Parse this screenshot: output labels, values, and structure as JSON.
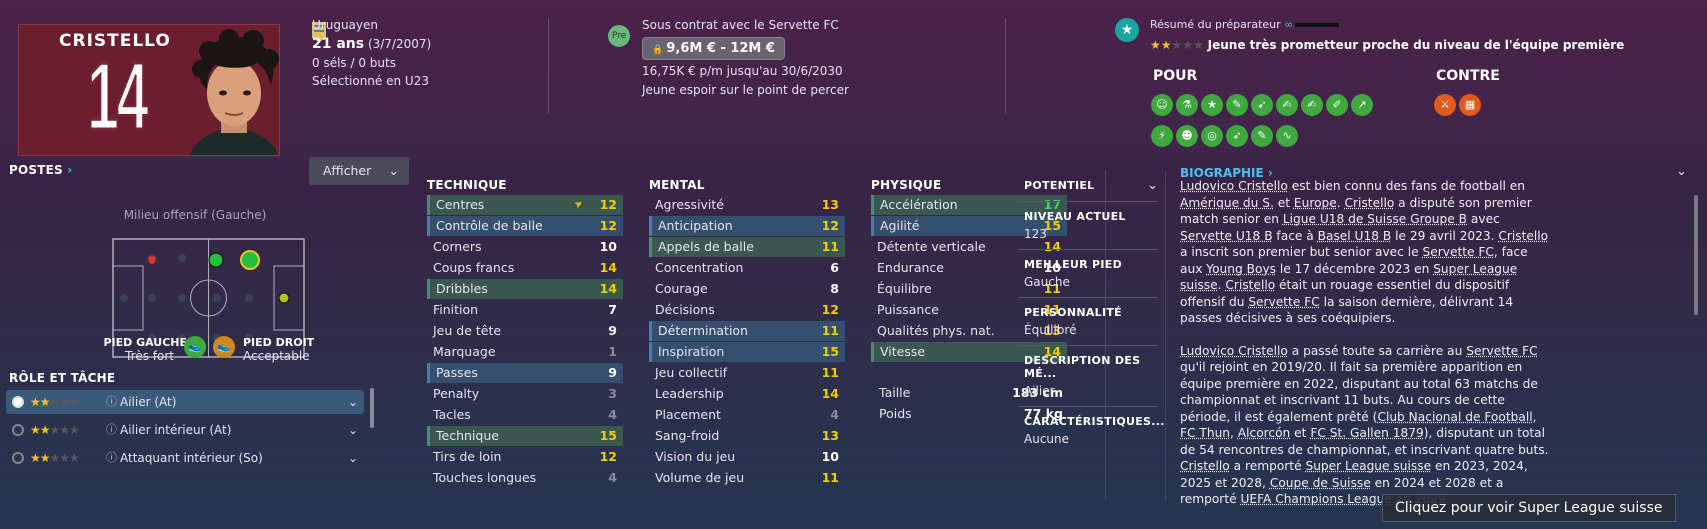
{
  "player": {
    "name": "CRISTELLO",
    "number": "14"
  },
  "info": {
    "nationality": "Uruguayen",
    "age": "21 ans",
    "dob": "(3/7/2007)",
    "caps": "0 séls / 0 buts",
    "selection": "Sélectionné en U23"
  },
  "contract": {
    "badge": "Pre",
    "title": "Sous contrat avec le Servette FC",
    "value": "9,6M € - 12M €",
    "wage": "16,75K € p/m jusqu'au 30/6/2030",
    "status": "Jeune espoir sur le point de percer"
  },
  "coach": {
    "title": "Résumé du préparateur",
    "summary": "Jeune très prometteur proche du niveau de l'équipe première",
    "stars": 2,
    "pour": "POUR",
    "contre": "CONTRE"
  },
  "positions": {
    "title": "POSTES",
    "button": "Afficher",
    "position": "Milieu offensif (Gauche)",
    "left_foot_label": "PIED GAUCHE",
    "left_foot": "Très fort",
    "right_foot_label": "PIED DROIT",
    "right_foot": "Acceptable"
  },
  "roles": {
    "title": "RÔLE ET TÂCHE",
    "items": [
      {
        "label": "Ailier (At)"
      },
      {
        "label": "Ailier intérieur (At)"
      },
      {
        "label": "Attaquant intérieur (So)"
      }
    ]
  },
  "technique": {
    "title": "TECHNIQUE",
    "items": [
      {
        "n": "Centres",
        "v": "12"
      },
      {
        "n": "Contrôle de balle",
        "v": "12"
      },
      {
        "n": "Corners",
        "v": "10"
      },
      {
        "n": "Coups francs",
        "v": "14"
      },
      {
        "n": "Dribbles",
        "v": "14"
      },
      {
        "n": "Finition",
        "v": "7"
      },
      {
        "n": "Jeu de tête",
        "v": "9"
      },
      {
        "n": "Marquage",
        "v": "1"
      },
      {
        "n": "Passes",
        "v": "9"
      },
      {
        "n": "Penalty",
        "v": "3"
      },
      {
        "n": "Tacles",
        "v": "4"
      },
      {
        "n": "Technique",
        "v": "15"
      },
      {
        "n": "Tirs de loin",
        "v": "12"
      },
      {
        "n": "Touches longues",
        "v": "4"
      }
    ]
  },
  "mental": {
    "title": "MENTAL",
    "items": [
      {
        "n": "Agressivité",
        "v": "13"
      },
      {
        "n": "Anticipation",
        "v": "12"
      },
      {
        "n": "Appels de balle",
        "v": "11"
      },
      {
        "n": "Concentration",
        "v": "6"
      },
      {
        "n": "Courage",
        "v": "8"
      },
      {
        "n": "Décisions",
        "v": "12"
      },
      {
        "n": "Détermination",
        "v": "11"
      },
      {
        "n": "Inspiration",
        "v": "15"
      },
      {
        "n": "Jeu collectif",
        "v": "11"
      },
      {
        "n": "Leadership",
        "v": "14"
      },
      {
        "n": "Placement",
        "v": "4"
      },
      {
        "n": "Sang-froid",
        "v": "13"
      },
      {
        "n": "Vision du jeu",
        "v": "10"
      },
      {
        "n": "Volume de jeu",
        "v": "11"
      }
    ]
  },
  "physique": {
    "title": "PHYSIQUE",
    "items": [
      {
        "n": "Accélération",
        "v": "17"
      },
      {
        "n": "Agilité",
        "v": "15"
      },
      {
        "n": "Détente verticale",
        "v": "14"
      },
      {
        "n": "Endurance",
        "v": "10"
      },
      {
        "n": "Équilibre",
        "v": "11"
      },
      {
        "n": "Puissance",
        "v": "11"
      },
      {
        "n": "Qualités phys. nat.",
        "v": "13"
      },
      {
        "n": "Vitesse",
        "v": "14"
      }
    ],
    "height_label": "Taille",
    "height": "183 cm",
    "weight_label": "Poids",
    "weight": "77 kg"
  },
  "side": {
    "potential": "POTENTIEL",
    "current_label": "NIVEAU ACTUEL",
    "current": "123",
    "foot_label": "MEILLEUR PIED",
    "foot": "Gauche",
    "pers_label": "PERSONNALITÉ",
    "pers": "Équilibré",
    "desc_label": "DESCRIPTION DES MÉ...",
    "desc": "Ailier",
    "car_label": "CARACTÉRISTIQUES...",
    "car": "Aucune"
  },
  "bio": {
    "title": "BIOGRAPHIE",
    "tooltip": "Cliquez pour voir Super League suisse"
  },
  "colors": {
    "yellow": "#f0d000",
    "green": "#3fdc5a",
    "grey": "#8e8a98"
  }
}
